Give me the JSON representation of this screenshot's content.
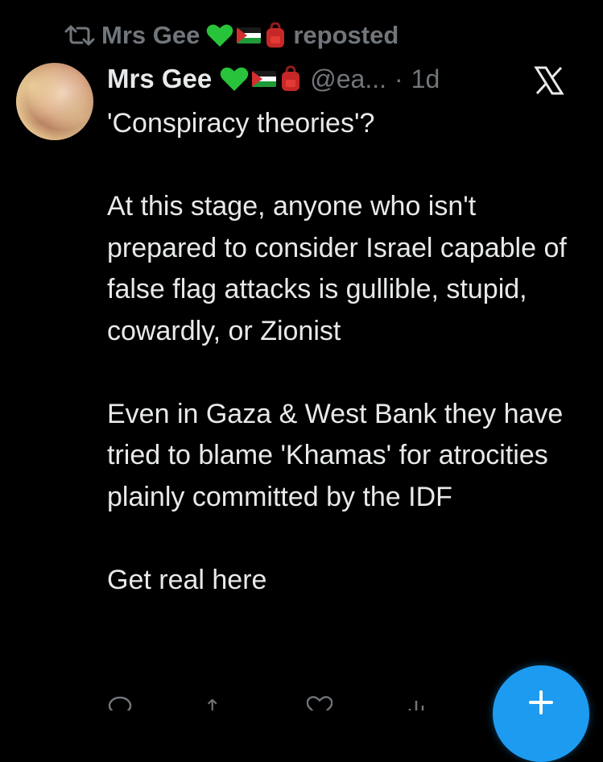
{
  "repost": {
    "user_name": "Mrs Gee",
    "label": "reposted",
    "icon": "repost-icon"
  },
  "tweet": {
    "avatar": "avatar",
    "display_name": "Mrs Gee",
    "emojis": [
      "green-heart-icon",
      "palestine-flag-icon",
      "backpack-icon"
    ],
    "handle": "@ea...",
    "separator": "·",
    "time": "1d",
    "text": "'Conspiracy theories'?\n\nAt this stage, anyone who isn't prepared to consider Israel capable of false flag attacks is gullible, stupid, cowardly, or Zionist\n\nEven in Gaza & West Bank they have tried to blame 'Khamas' for atrocities plainly committed by the IDF\n\nGet real here"
  },
  "actions": {
    "reply_icon": "reply-icon",
    "repost_icon": "repost-icon",
    "like_icon": "like-icon",
    "views_icon": "views-icon"
  },
  "fab": {
    "icon": "plus-icon",
    "color": "#1d9bf0"
  },
  "colors": {
    "background": "#000000",
    "text": "#e7e9ea",
    "muted": "#71767b",
    "accent": "#1d9bf0"
  }
}
